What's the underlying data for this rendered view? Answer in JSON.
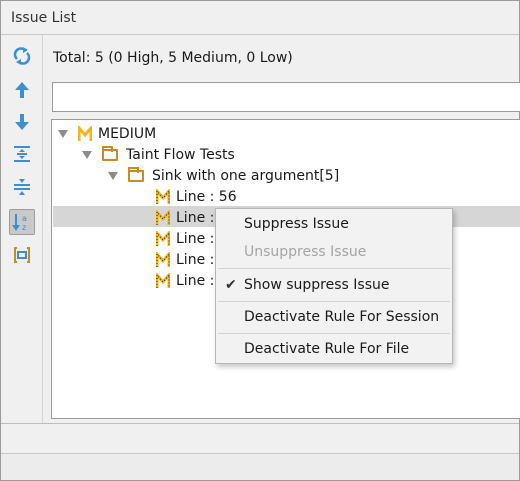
{
  "panel": {
    "title": "Issue List"
  },
  "summary": {
    "total": "Total: 5 (0 High, 5 Medium, 0 Low)"
  },
  "search": {
    "placeholder": ""
  },
  "toolbar": {
    "buttons": [
      {
        "name": "refresh-icon"
      },
      {
        "name": "arrow-up-icon"
      },
      {
        "name": "arrow-down-icon"
      },
      {
        "name": "expand-all-icon"
      },
      {
        "name": "collapse-all-icon"
      },
      {
        "name": "sort-az-icon",
        "active": true
      },
      {
        "name": "group-icon"
      }
    ]
  },
  "tree": {
    "severity": "MEDIUM",
    "category": "Taint Flow Tests",
    "rule": "Sink with one argument[5]",
    "items": [
      "Line : 56",
      "Line :",
      "Line :",
      "Line :",
      "Line :"
    ],
    "selected_index": 1
  },
  "context_menu": {
    "items": [
      {
        "label": "Suppress Issue",
        "enabled": true,
        "checked": false
      },
      {
        "label": "Unsuppress Issue",
        "enabled": false,
        "checked": false
      },
      {
        "label": "Show suppress Issue",
        "enabled": true,
        "checked": true
      },
      {
        "label": "Deactivate Rule For Session",
        "enabled": true,
        "checked": false
      },
      {
        "label": "Deactivate Rule For File",
        "enabled": true,
        "checked": false
      }
    ]
  },
  "colors": {
    "accent_blue": "#3f8fd0",
    "severity_medium": "#f2b51d",
    "folder": "#c98a2a",
    "selection": "#d6d6d6"
  }
}
